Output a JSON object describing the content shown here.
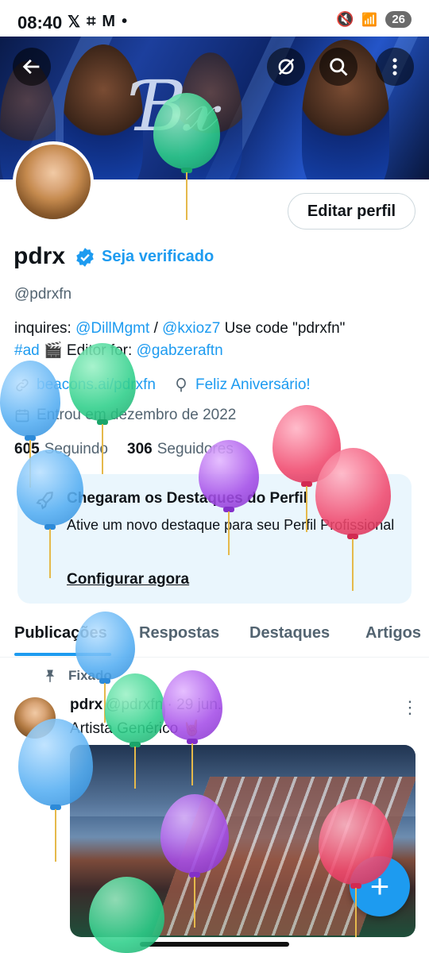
{
  "status_bar": {
    "time": "08:40",
    "battery": "26"
  },
  "profile": {
    "name": "pdrx",
    "get_verified": "Seja verificado",
    "handle": "@pdrxfn",
    "edit_button": "Editar perfil",
    "bio": {
      "prefix": "inquires: ",
      "mention1": "@DillMgmt",
      "sep": " / ",
      "mention2": "@kxioz7",
      "mid": " Use code \"pdrxfn\"",
      "hashtag": "#ad",
      "emoji": " 🎬 Editor for: ",
      "mention3": "@gabzeraftn"
    },
    "website": "beacons.ai/pdrxfn",
    "birthday": "Feliz Aniversário!",
    "joined": "Entrou em dezembro de 2022",
    "following_count": "605",
    "following_label": "Seguindo",
    "followers_count": "306",
    "followers_label": "Seguidores"
  },
  "highlight_card": {
    "title": "Chegaram os Destaques do Perfil",
    "description": "Ative um novo destaque para seu Perfil Profissional",
    "action": "Configurar agora"
  },
  "tabs": [
    "Publicações",
    "Respostas",
    "Destaques",
    "Artigos"
  ],
  "post": {
    "pinned_label": "Fixado",
    "author": "pdrx",
    "handle_date": "@pdrxfn · 29 jun.",
    "text": "Artista Genérico 🤘"
  },
  "colors": {
    "accent": "#1d9bf0",
    "card_bg": "#eaf6fd",
    "text": "#0f1419",
    "muted": "#536471"
  }
}
